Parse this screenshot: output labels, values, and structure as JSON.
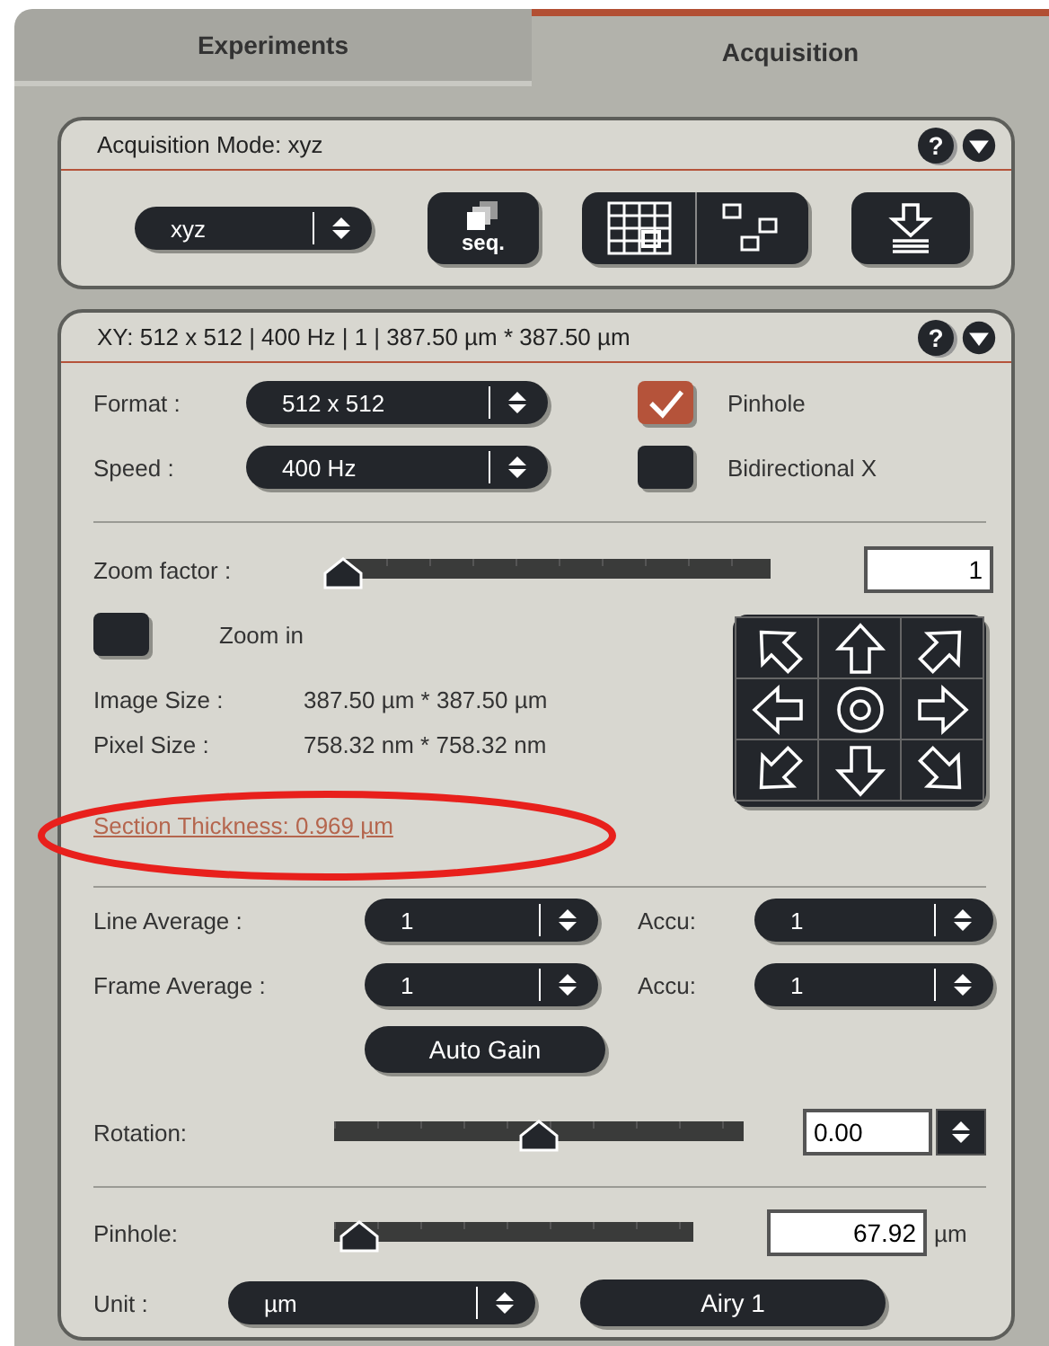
{
  "tabs": [
    {
      "label": "Experiments",
      "selected": false
    },
    {
      "label": "Acquisition",
      "selected": true
    }
  ],
  "mode_panel": {
    "title": "Acquisition Mode: xyz",
    "help": "?",
    "mode": "xyz",
    "seq_label": "seq."
  },
  "scan_panel": {
    "title": "XY:  512 x 512 | 400 Hz | 1 | 387.50 µm * 387.50 µm",
    "help": "?",
    "format": {
      "label": "Format :",
      "value": "512 x 512"
    },
    "speed": {
      "label": "Speed :",
      "value": "400 Hz"
    },
    "checks": [
      {
        "label": "Pinhole",
        "checked": true
      },
      {
        "label": "Bidirectional X",
        "checked": false
      }
    ],
    "zoom": {
      "label": "Zoom factor :",
      "level": 0.0,
      "value": "1"
    },
    "zoom_in": {
      "label": "Zoom in",
      "checked": false
    },
    "info": [
      {
        "label": "Image Size :",
        "value": "387.50 µm * 387.50 µm"
      },
      {
        "label": "Pixel Size :",
        "value": "758.32 nm * 758.32 nm"
      }
    ],
    "section_thickness": "Section Thickness: 0.969 µm",
    "averages": [
      {
        "label": "Line Average :",
        "value": "1",
        "accu_label": "Accu:",
        "accu": "1"
      },
      {
        "label": "Frame Average :",
        "value": "1",
        "accu_label": "Accu:",
        "accu": "1"
      }
    ],
    "auto_gain": "Auto Gain",
    "rotation": {
      "label": "Rotation:",
      "level": 0.5,
      "value": "0.00"
    },
    "pinhole": {
      "label": "Pinhole:",
      "level": 0.07,
      "value": "67.92",
      "unit": "µm"
    },
    "unit": {
      "label": "Unit :",
      "value": "µm"
    },
    "airy": "Airy 1"
  }
}
